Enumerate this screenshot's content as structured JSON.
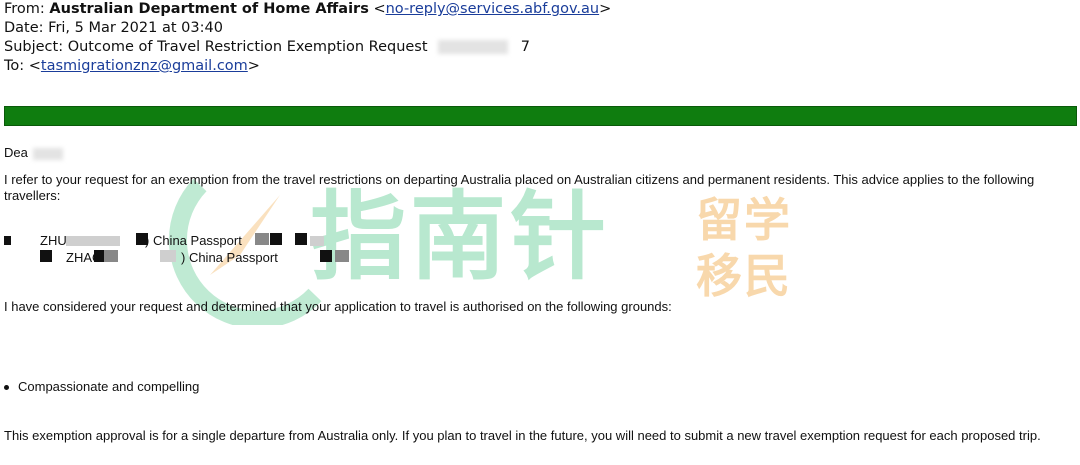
{
  "email": {
    "from_label": "From:",
    "from_name": "Australian Department of Home Affairs",
    "from_email_prefix": "<",
    "from_email": "no-reply@services.abf.gov.au",
    "from_email_suffix": ">",
    "date_label": "Date:",
    "date_value": "Fri, 5 Mar 2021 at 03:40",
    "subject_label": "Subject:",
    "subject_value": "Outcome of Travel Restriction Exemption Request",
    "subject_tail": "7",
    "to_label": "To:",
    "to_prefix": "<",
    "to_email": "tasmigrationznz@gmail.com",
    "to_suffix": ">"
  },
  "banner_color": "#0f7d0f",
  "letter": {
    "greeting": "Dea",
    "intro": "I refer to your request for an exemption from the travel restrictions on departing Australia placed on Australian citizens and permanent residents. This advice applies to the following travellers:",
    "traveller1_surname": "ZHU",
    "traveller1_passport": ") China Passport",
    "traveller2_surname": "ZHAO",
    "traveller2_passport": ") China Passport",
    "decision": "I have considered your request and determined that your application to travel is authorised on the following grounds:",
    "ground": "Compassionate and compelling",
    "closing": "This exemption approval is for a single departure from Australia only. If you plan to travel in the future, you will need to submit a new travel exemption request for each proposed trip."
  },
  "watermark": {
    "main_text": "指南针",
    "side_top": "留学",
    "side_bottom": "移民"
  }
}
